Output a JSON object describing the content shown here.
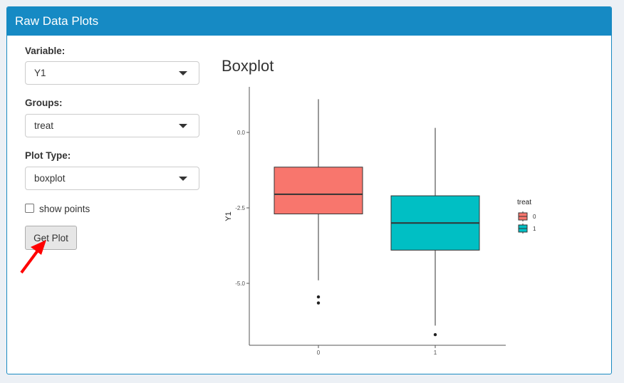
{
  "panel": {
    "title": "Raw Data Plots"
  },
  "controls": {
    "variable": {
      "label": "Variable:",
      "value": "Y1"
    },
    "groups": {
      "label": "Groups:",
      "value": "treat"
    },
    "plot_type": {
      "label": "Plot Type:",
      "value": "boxplot"
    },
    "show_points": {
      "label": "show points",
      "checked": false
    },
    "get_plot_label": "Get Plot"
  },
  "plot_title": "Boxplot",
  "annotation": {
    "arrow_color": "#ff0000"
  },
  "chart_data": {
    "type": "boxplot",
    "title": "",
    "xlabel": "",
    "ylabel": "Y1",
    "categories": [
      "0",
      "1"
    ],
    "y_ticks": [
      "0.0",
      "-2.5",
      "-5.0"
    ],
    "ylim": [
      -7.2,
      1.5
    ],
    "legend": {
      "title": "treat",
      "position": "right",
      "entries": [
        "0",
        "1"
      ]
    },
    "boxes": [
      {
        "group": "0",
        "color": "#f8766d",
        "whisker_low": -4.9,
        "q1": -2.7,
        "median": -2.05,
        "q3": -1.15,
        "whisker_high": 1.1,
        "outliers": [
          -5.45,
          -5.65
        ]
      },
      {
        "group": "1",
        "color": "#00bfc4",
        "whisker_low": -6.4,
        "q1": -3.9,
        "median": -3.0,
        "q3": -2.1,
        "whisker_high": 0.15,
        "outliers": [
          -6.7
        ]
      }
    ]
  }
}
